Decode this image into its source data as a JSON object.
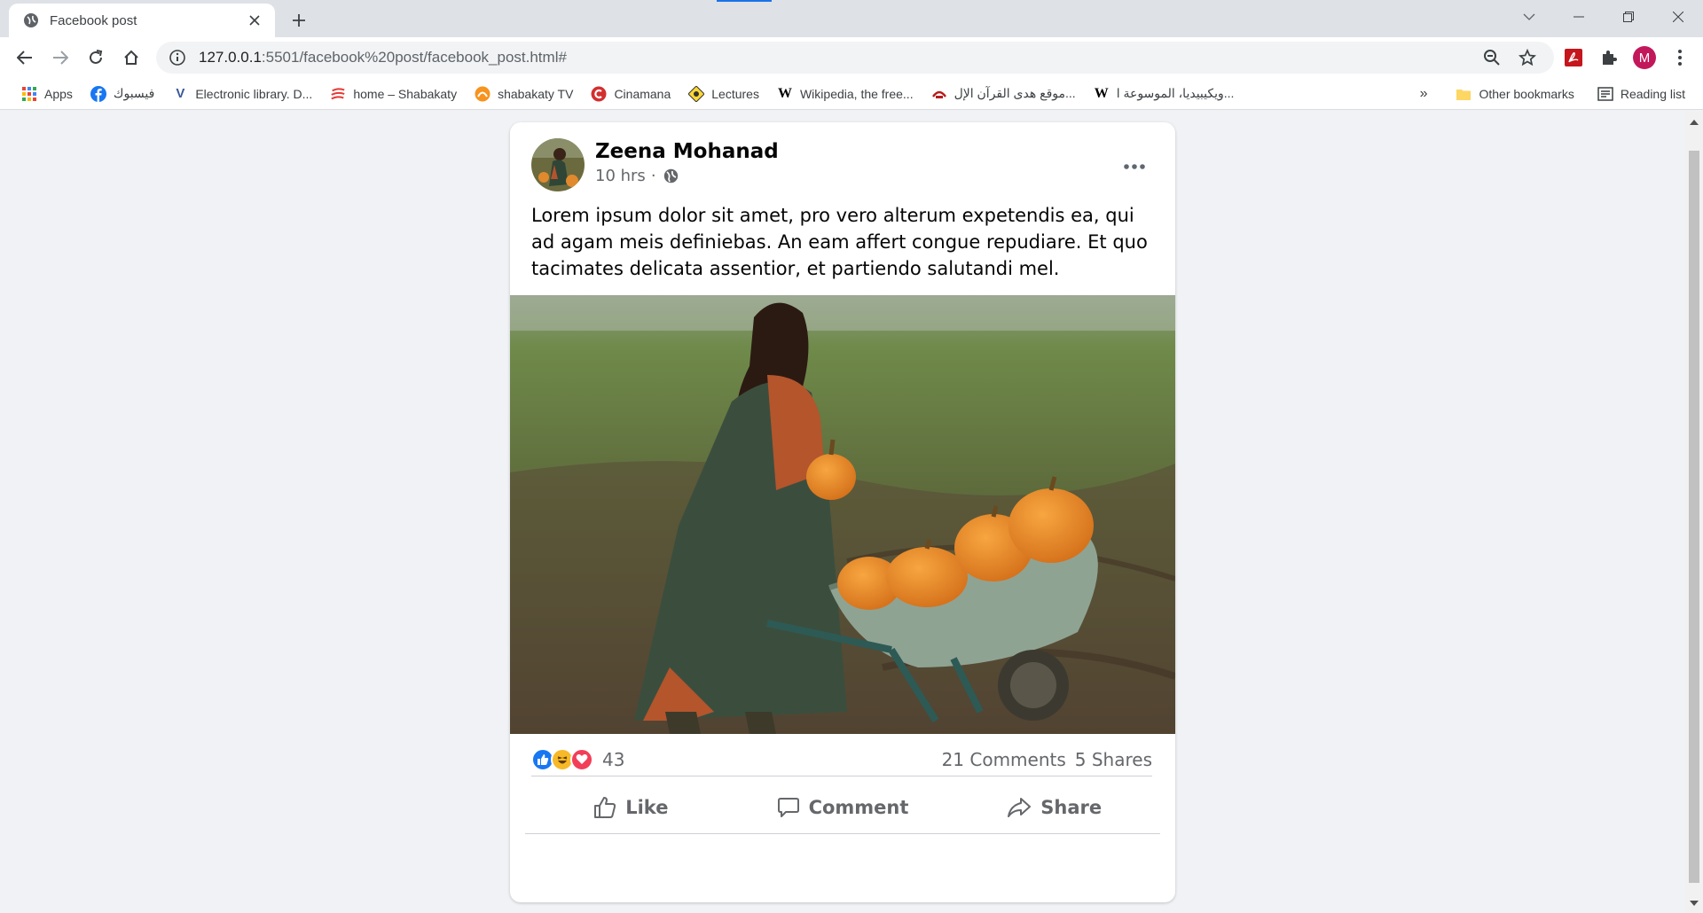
{
  "browser": {
    "tab_title": "Facebook post",
    "url_host": "127.0.0.1",
    "url_rest": ":5501/facebook%20post/facebook_post.html#",
    "profile_initial": "M"
  },
  "bookmarks": [
    {
      "label": "Apps",
      "icon": "apps-grid-icon"
    },
    {
      "label": "فيسبوك",
      "icon": "facebook-icon"
    },
    {
      "label": "Electronic library. D...",
      "icon": "y-icon"
    },
    {
      "label": "home – Shabakaty",
      "icon": "shabakaty-icon"
    },
    {
      "label": "shabakaty TV",
      "icon": "shabakaty-tv-icon"
    },
    {
      "label": "Cinamana",
      "icon": "cinamana-icon"
    },
    {
      "label": "Lectures",
      "icon": "lectures-icon"
    },
    {
      "label": "Wikipedia, the free...",
      "icon": "wikipedia-icon"
    },
    {
      "label": "موقع هدى القرآن الإل...",
      "icon": "quran-site-icon"
    },
    {
      "label": "ويكيبيديا، الموسوعة ا...",
      "icon": "wikipedia-icon"
    }
  ],
  "bookmarks_right": {
    "overflow": "»",
    "other": "Other bookmarks",
    "reading_list": "Reading list"
  },
  "post": {
    "author": "Zeena Mohanad",
    "time": "10 hrs",
    "separator": "·",
    "text": "Lorem ipsum dolor sit amet, pro vero alterum expetendis ea, qui ad agam meis definiebas. An eam affert congue repudiare. Et quo tacimates delicata assentior, et partiendo salutandi mel.",
    "reactions_count": "43",
    "comments": "21 Comments",
    "shares": "5 Shares",
    "actions": {
      "like": "Like",
      "comment": "Comment",
      "share": "Share"
    }
  },
  "colors": {
    "like_blue": "#1877f2",
    "love_red": "#f33e58",
    "haha_yellow": "#f7b928",
    "meta_gray": "#65676b"
  }
}
